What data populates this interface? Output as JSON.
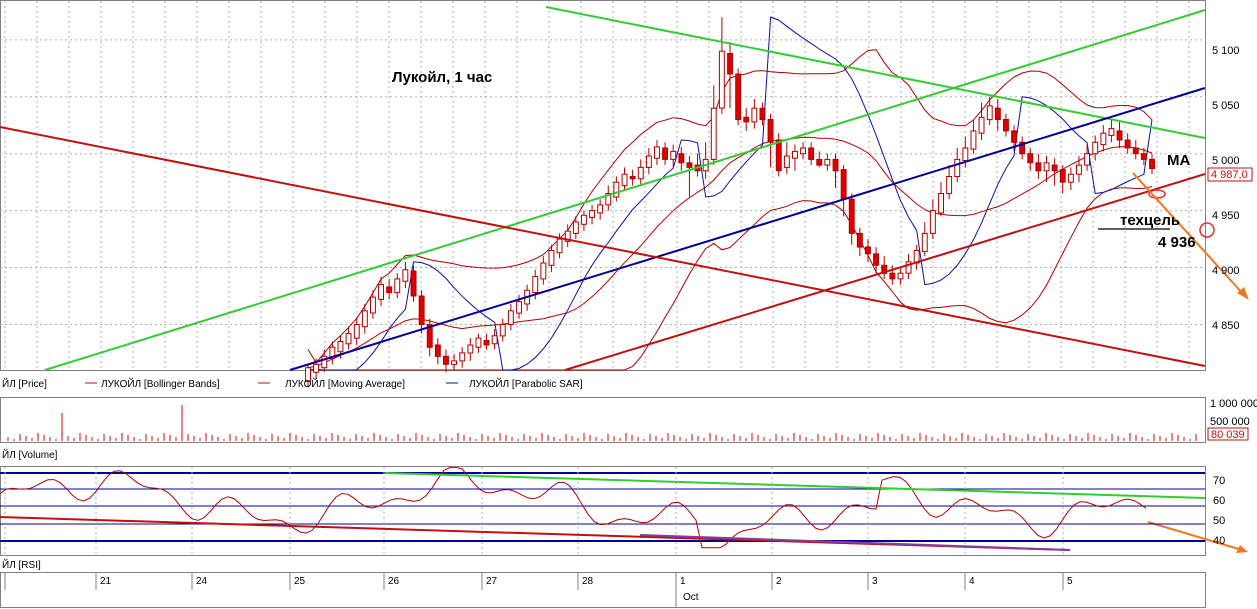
{
  "colors": {
    "bg": "#ffffff",
    "grid": "#b0b0b0",
    "candle_up": "#ffffff",
    "candle_down": "#e00000",
    "candle_outline": "#b00000",
    "bollinger": "#b00000",
    "moving_average": "#c00000",
    "parabolic_sar": "#1010a0",
    "trend_green": "#33cc33",
    "trend_blue": "#000099",
    "trend_red": "#c01010",
    "arrow_orange": "#f07820",
    "rsi_line": "#b00000",
    "rsi_level": "#000099",
    "volume": "#e00000"
  },
  "main_panel": {
    "title": "Лукойл, 1 час",
    "annotation_ma": "МА",
    "annotation_target_label": "техцель",
    "annotation_target_value": "4 936",
    "last_price_badge": "4 987,0",
    "y_ticks": [
      "5 100",
      "5 050",
      "5 000",
      "4 950",
      "4 900",
      "4 850"
    ],
    "legend": [
      {
        "text": "ЙЛ [Price]",
        "icon": "none"
      },
      {
        "text": "ЛУКОЙЛ [Bollinger Bands]",
        "icon": "red-line"
      },
      {
        "text": "ЛУКОЙЛ [Moving Average]",
        "icon": "red-line"
      },
      {
        "text": "ЛУКОЙЛ [Parabolic SAR]",
        "icon": "blue-line"
      }
    ]
  },
  "volume_panel": {
    "y_ticks": [
      "1 000 000",
      "500 000"
    ],
    "last_value_badge": "80 039",
    "legend": "ЙЛ [Volume]"
  },
  "rsi_panel": {
    "y_ticks": [
      "70",
      "60",
      "50",
      "40"
    ],
    "legend": "ЙЛ [RSI]"
  },
  "time_axis": {
    "day_labels": [
      "21",
      "24",
      "25",
      "26",
      "27",
      "28",
      "1",
      "2",
      "3",
      "4",
      "5"
    ],
    "month_label": "Oct"
  },
  "chart_data": {
    "type": "candlestick",
    "title": "Лукойл, 1 час",
    "ylim": [
      4810,
      5135
    ],
    "candles": [
      [
        4800,
        4812,
        4795,
        4815
      ],
      [
        4808,
        4815,
        4802,
        4820
      ],
      [
        4812,
        4822,
        4808,
        4828
      ],
      [
        4820,
        4830,
        4815,
        4835
      ],
      [
        4826,
        4835,
        4820,
        4840
      ],
      [
        4833,
        4842,
        4828,
        4848
      ],
      [
        4838,
        4850,
        4832,
        4856
      ],
      [
        4848,
        4862,
        4842,
        4868
      ],
      [
        4860,
        4874,
        4855,
        4880
      ],
      [
        4872,
        4885,
        4866,
        4892
      ],
      [
        4883,
        4878,
        4872,
        4890
      ],
      [
        4878,
        4890,
        4873,
        4895
      ],
      [
        4888,
        4898,
        4882,
        4905
      ],
      [
        4897,
        4875,
        4870,
        4902
      ],
      [
        4875,
        4850,
        4842,
        4880
      ],
      [
        4850,
        4830,
        4822,
        4855
      ],
      [
        4832,
        4822,
        4815,
        4838
      ],
      [
        4822,
        4815,
        4808,
        4828
      ],
      [
        4815,
        4818,
        4810,
        4824
      ],
      [
        4818,
        4825,
        4812,
        4830
      ],
      [
        4825,
        4832,
        4818,
        4838
      ],
      [
        4830,
        4838,
        4825,
        4842
      ],
      [
        4836,
        4832,
        4828,
        4842
      ],
      [
        4833,
        4840,
        4828,
        4846
      ],
      [
        4840,
        4850,
        4835,
        4855
      ],
      [
        4850,
        4862,
        4845,
        4868
      ],
      [
        4860,
        4870,
        4855,
        4876
      ],
      [
        4868,
        4880,
        4862,
        4885
      ],
      [
        4878,
        4892,
        4872,
        4898
      ],
      [
        4890,
        4904,
        4885,
        4910
      ],
      [
        4902,
        4915,
        4896,
        4920
      ],
      [
        4913,
        4925,
        4908,
        4930
      ],
      [
        4923,
        4932,
        4918,
        4938
      ],
      [
        4930,
        4940,
        4925,
        4945
      ],
      [
        4938,
        4946,
        4932,
        4950
      ],
      [
        4944,
        4950,
        4938,
        4955
      ],
      [
        4948,
        4955,
        4942,
        4960
      ],
      [
        4955,
        4965,
        4950,
        4972
      ],
      [
        4962,
        4975,
        4958,
        4980
      ],
      [
        4972,
        4982,
        4968,
        4988
      ],
      [
        4980,
        4978,
        4972,
        4986
      ],
      [
        4978,
        4988,
        4972,
        4995
      ],
      [
        4988,
        4998,
        4982,
        5005
      ],
      [
        4996,
        5006,
        4990,
        5012
      ],
      [
        5005,
        4995,
        4990,
        5010
      ],
      [
        4995,
        5002,
        4988,
        5008
      ],
      [
        5000,
        4992,
        4985,
        5006
      ],
      [
        4992,
        4988,
        4962,
        4998
      ],
      [
        4990,
        4985,
        4980,
        5000
      ],
      [
        4985,
        4995,
        4978,
        5010
      ],
      [
        4995,
        5040,
        4990,
        5060
      ],
      [
        5040,
        5090,
        5035,
        5120
      ],
      [
        5088,
        5070,
        5040,
        5098
      ],
      [
        5070,
        5030,
        5025,
        5075
      ],
      [
        5032,
        5028,
        5020,
        5040
      ],
      [
        5028,
        5040,
        5022,
        5048
      ],
      [
        5040,
        5030,
        5025,
        5045
      ],
      [
        5030,
        5010,
        4988,
        5035
      ],
      [
        5012,
        4985,
        4980,
        5018
      ],
      [
        4988,
        4998,
        4982,
        5010
      ],
      [
        4996,
        5002,
        4985,
        5008
      ],
      [
        5000,
        5005,
        4995,
        5010
      ],
      [
        5005,
        4995,
        4990,
        5010
      ],
      [
        4995,
        4990,
        4988,
        5002
      ],
      [
        4990,
        4995,
        4985,
        5000
      ],
      [
        4995,
        4985,
        4970,
        5000
      ],
      [
        4986,
        4960,
        4945,
        4990
      ],
      [
        4960,
        4930,
        4920,
        4965
      ],
      [
        4930,
        4918,
        4910,
        4935
      ],
      [
        4918,
        4912,
        4905,
        4925
      ],
      [
        4912,
        4902,
        4895,
        4918
      ],
      [
        4902,
        4895,
        4890,
        4910
      ],
      [
        4895,
        4890,
        4885,
        4902
      ],
      [
        4890,
        4895,
        4885,
        4900
      ],
      [
        4895,
        4905,
        4890,
        4912
      ],
      [
        4904,
        4915,
        4898,
        4920
      ],
      [
        4914,
        4930,
        4910,
        4940
      ],
      [
        4930,
        4950,
        4925,
        4960
      ],
      [
        4948,
        4965,
        4945,
        4975
      ],
      [
        4965,
        4980,
        4960,
        4990
      ],
      [
        4980,
        4995,
        4975,
        5005
      ],
      [
        4994,
        5005,
        4988,
        5015
      ],
      [
        5004,
        5020,
        5000,
        5030
      ],
      [
        5018,
        5032,
        5012,
        5045
      ],
      [
        5030,
        5042,
        5025,
        5050
      ],
      [
        5040,
        5030,
        5020,
        5048
      ],
      [
        5030,
        5020,
        5015,
        5035
      ],
      [
        5020,
        5010,
        5002,
        5025
      ],
      [
        5010,
        5000,
        4995,
        5015
      ],
      [
        5000,
        4992,
        4985,
        5005
      ],
      [
        4992,
        4985,
        4978,
        5000
      ],
      [
        4985,
        4992,
        4975,
        4998
      ],
      [
        4990,
        4985,
        4972,
        4996
      ],
      [
        4986,
        4975,
        4965,
        4990
      ],
      [
        4975,
        4982,
        4968,
        4988
      ],
      [
        4982,
        4990,
        4975,
        4998
      ],
      [
        4990,
        5000,
        4985,
        5008
      ],
      [
        5000,
        5010,
        4994,
        5016
      ],
      [
        5008,
        5018,
        5002,
        5025
      ],
      [
        5016,
        5022,
        5010,
        5030
      ],
      [
        5020,
        5012,
        5005,
        5028
      ],
      [
        5012,
        5005,
        5000,
        5018
      ],
      [
        5005,
        5000,
        4995,
        5012
      ],
      [
        5000,
        4995,
        4990,
        5005
      ],
      [
        4995,
        4987,
        4982,
        5000
      ]
    ]
  }
}
